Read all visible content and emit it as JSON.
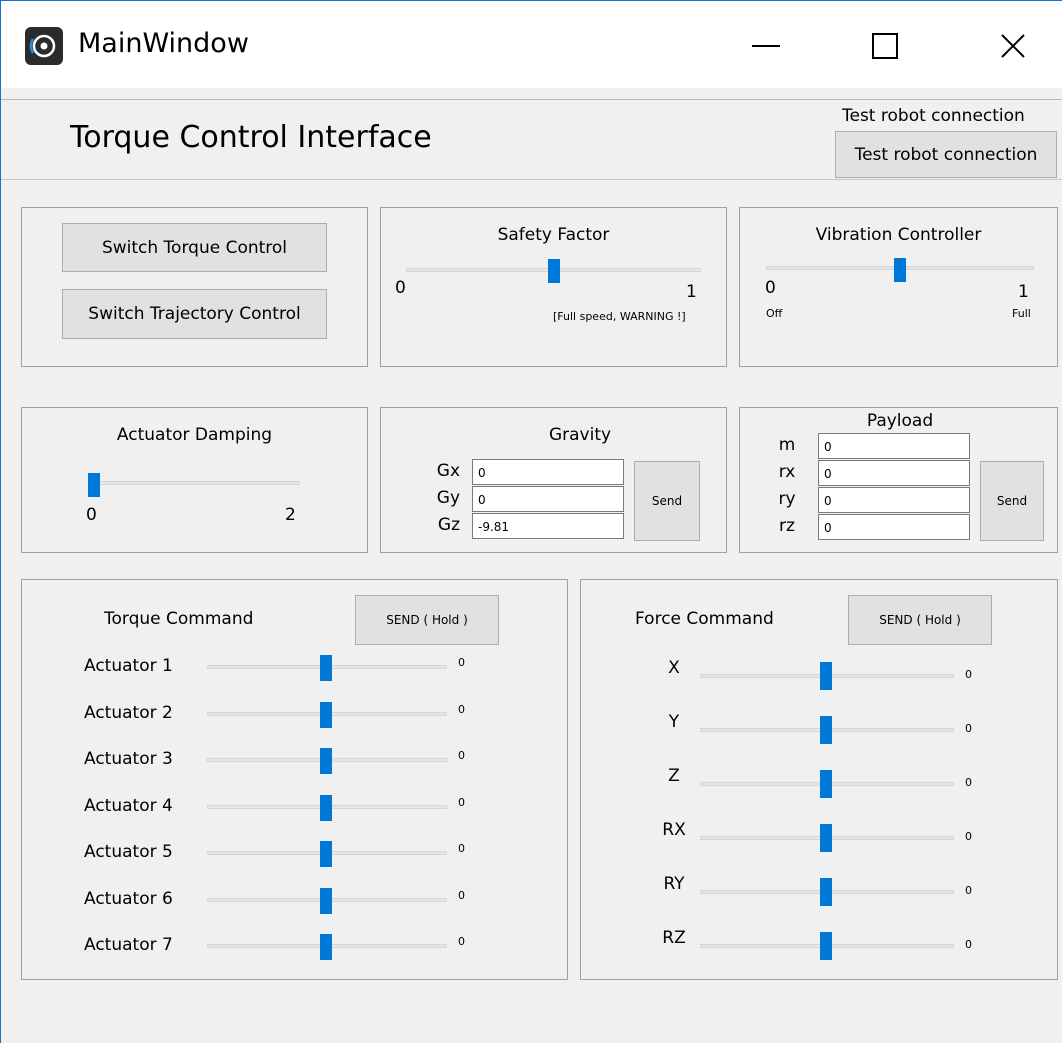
{
  "window": {
    "title": "MainWindow",
    "minimize": "—",
    "close": "✕"
  },
  "header": {
    "title": "Torque Control Interface",
    "test_label": "Test robot connection",
    "test_button": "Test robot connection"
  },
  "mode": {
    "torque_button": "Switch Torque Control",
    "trajectory_button": "Switch Trajectory Control"
  },
  "safety": {
    "title": "Safety Factor",
    "min": "0",
    "max": "1",
    "note": "[Full speed, WARNING !]",
    "value": 0.5
  },
  "vibration": {
    "title": "Vibration Controller",
    "min": "0",
    "max": "1",
    "min_note": "Off",
    "max_note": "Full",
    "value": 0.5
  },
  "damping": {
    "title": "Actuator Damping",
    "min": "0",
    "max": "2",
    "value": 0
  },
  "gravity": {
    "title": "Gravity",
    "fields": [
      {
        "label": "Gx",
        "value": "0"
      },
      {
        "label": "Gy",
        "value": "0"
      },
      {
        "label": "Gz",
        "value": "-9.81"
      }
    ],
    "send": "Send"
  },
  "payload": {
    "title": "Payload",
    "fields": [
      {
        "label": "m",
        "value": "0"
      },
      {
        "label": "rx",
        "value": "0"
      },
      {
        "label": "ry",
        "value": "0"
      },
      {
        "label": "rz",
        "value": "0"
      }
    ],
    "send": "Send"
  },
  "torque": {
    "title": "Torque Command",
    "send": "SEND ( Hold )",
    "rows": [
      {
        "label": "Actuator 1",
        "value": "0"
      },
      {
        "label": "Actuator 2",
        "value": "0"
      },
      {
        "label": "Actuator 3",
        "value": "0"
      },
      {
        "label": "Actuator 4",
        "value": "0"
      },
      {
        "label": "Actuator 5",
        "value": "0"
      },
      {
        "label": "Actuator 6",
        "value": "0"
      },
      {
        "label": "Actuator 7",
        "value": "0"
      }
    ]
  },
  "force": {
    "title": "Force Command",
    "send": "SEND ( Hold )",
    "rows": [
      {
        "label": "X",
        "value": "0"
      },
      {
        "label": "Y",
        "value": "0"
      },
      {
        "label": "Z",
        "value": "0"
      },
      {
        "label": "RX",
        "value": "0"
      },
      {
        "label": "RY",
        "value": "0"
      },
      {
        "label": "RZ",
        "value": "0"
      }
    ]
  },
  "colors": {
    "accent": "#0078d7",
    "window_border": "#1a73c8"
  }
}
